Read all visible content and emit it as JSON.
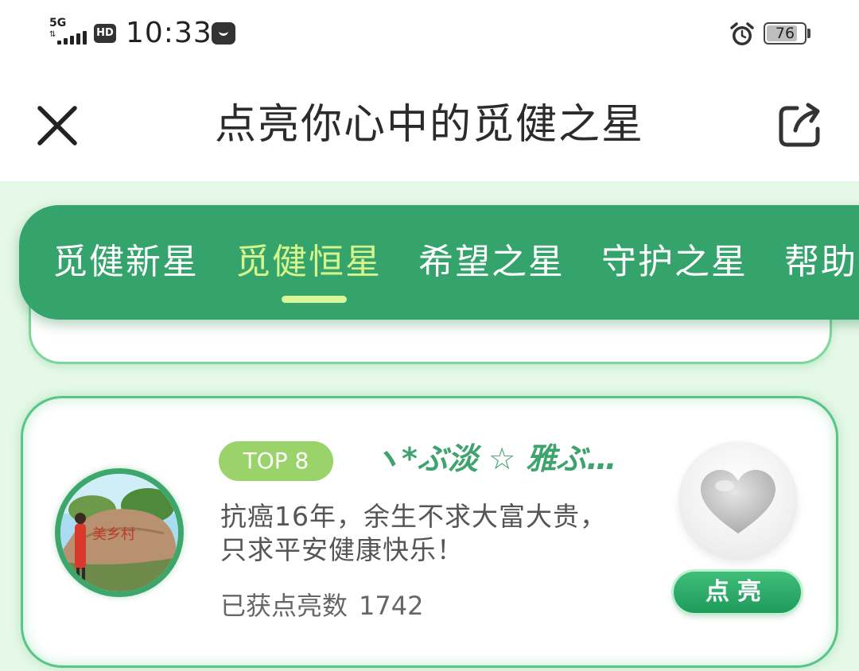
{
  "status_bar": {
    "network": "5G",
    "hd": "HD",
    "time": "10:33",
    "battery_level": "76",
    "icons": [
      "signal-icon",
      "hd-icon",
      "notification-icon",
      "alarm-icon",
      "battery-icon"
    ]
  },
  "header": {
    "title": "点亮你心中的觅健之星",
    "close_icon": "close-icon",
    "share_icon": "share-icon"
  },
  "tabs": [
    {
      "label": "觅健新星",
      "active": false
    },
    {
      "label": "觅健恒星",
      "active": true
    },
    {
      "label": "希望之星",
      "active": false
    },
    {
      "label": "守护之星",
      "active": false
    },
    {
      "label": "帮助",
      "active": false
    }
  ],
  "card": {
    "rank": "TOP 8",
    "nickname": "ヽ*ぶ淡 ☆ 雅ぶ…",
    "motto_lines": [
      "抗癌16年，余生不求大富大贵，",
      "只求平安健康快乐！"
    ],
    "count_label": "已获点亮数",
    "count_value": "1742",
    "button_label": "点亮",
    "heart_icon": "heart-icon"
  },
  "colors": {
    "primary_green": "#34a46c",
    "active_tab": "#d6f58a",
    "background_green": "#e6f9e8",
    "rank_badge": "#9ad36a"
  }
}
